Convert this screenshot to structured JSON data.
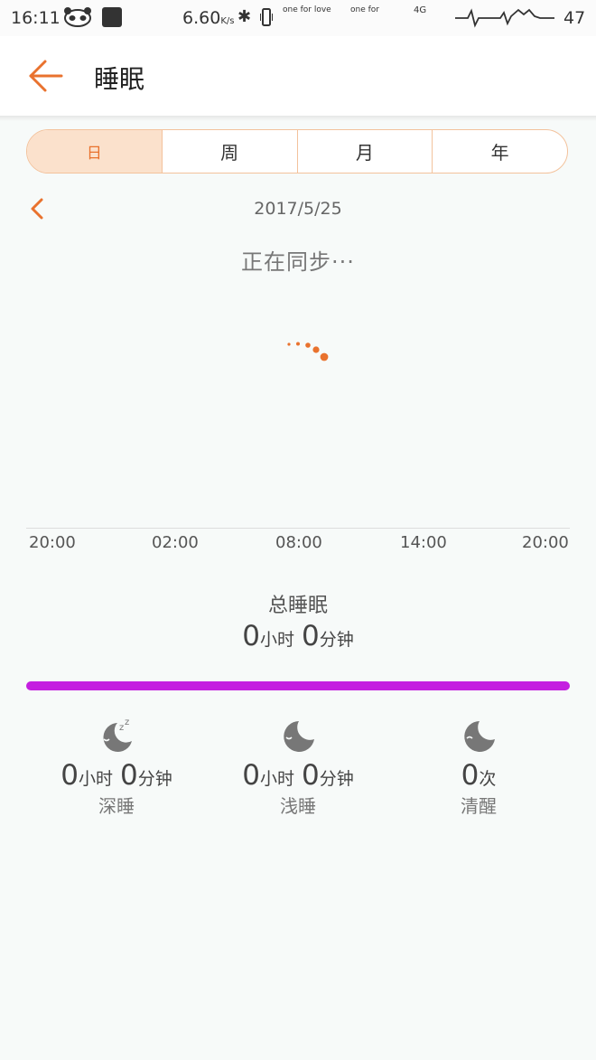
{
  "status_bar": {
    "time": "16:11",
    "net_speed": "6.60",
    "net_unit": "K/s",
    "carrier_text_1": "one for love",
    "carrier_text_2": "one for",
    "signal": "4G",
    "battery": "47"
  },
  "header": {
    "title": "睡眠"
  },
  "tabs": [
    {
      "label": "日",
      "active": true
    },
    {
      "label": "周",
      "active": false
    },
    {
      "label": "月",
      "active": false
    },
    {
      "label": "年",
      "active": false
    }
  ],
  "date": "2017/5/25",
  "sync_status": "正在同步···",
  "axis_ticks": [
    "20:00",
    "02:00",
    "08:00",
    "14:00",
    "20:00"
  ],
  "total": {
    "label": "总睡眠",
    "hours": "0",
    "hours_unit": "小时",
    "minutes": "0",
    "minutes_unit": "分钟"
  },
  "stats": [
    {
      "icon": "deep-sleep-icon",
      "hours": "0",
      "hours_unit": "小时",
      "minutes": "0",
      "minutes_unit": "分钟",
      "label": "深睡"
    },
    {
      "icon": "light-sleep-icon",
      "hours": "0",
      "hours_unit": "小时",
      "minutes": "0",
      "minutes_unit": "分钟",
      "label": "浅睡"
    },
    {
      "icon": "awake-icon",
      "count": "0",
      "count_unit": "次",
      "label": "清醒"
    }
  ],
  "colors": {
    "accent": "#e9722e",
    "bar": "#c41fe0",
    "icon": "#777777"
  }
}
